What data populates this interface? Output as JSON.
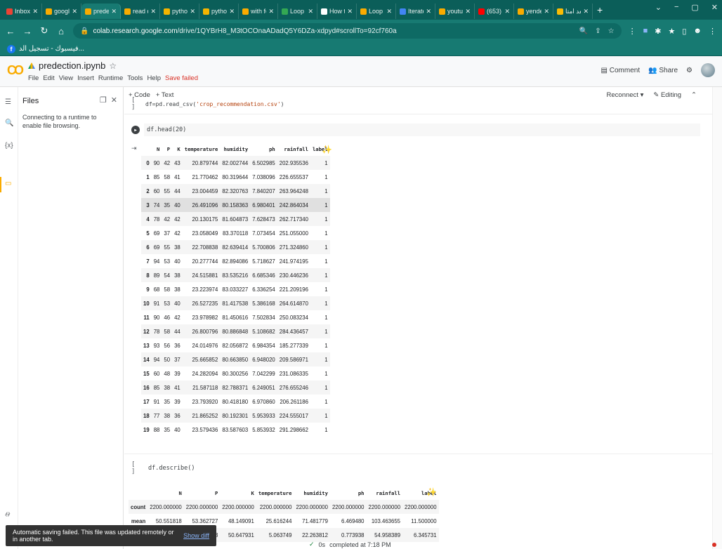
{
  "browser": {
    "tabs": [
      {
        "title": "Inbox (1",
        "color": "#ea4335",
        "active": false
      },
      {
        "title": "google ·",
        "color": "#f9ab00",
        "active": false
      },
      {
        "title": "predecti",
        "color": "#f9ab00",
        "active": true
      },
      {
        "title": "read dat",
        "color": "#f9ab00",
        "active": false
      },
      {
        "title": "python",
        "color": "#f4b400",
        "active": false
      },
      {
        "title": "python",
        "color": "#f4b400",
        "active": false
      },
      {
        "title": "with for",
        "color": "#f9ab00",
        "active": false
      },
      {
        "title": "Loop or",
        "color": "#34a853",
        "active": false
      },
      {
        "title": "How to",
        "color": "#ffffff",
        "active": false
      },
      {
        "title": "Loop or",
        "color": "#f9ab00",
        "active": false
      },
      {
        "title": "Iterate T",
        "color": "#4285f4",
        "active": false
      },
      {
        "title": "youtub",
        "color": "#f9ab00",
        "active": false
      },
      {
        "title": "(653) C",
        "color": "#ff0000",
        "active": false
      },
      {
        "title": "yendex",
        "color": "#f9ab00",
        "active": false
      },
      {
        "title": "بعد امتا",
        "color": "#fbbc04",
        "active": false
      }
    ],
    "new_tab": "+",
    "url_host": "colab.research.google.com",
    "url_path": "/drive/1QYBrH8_M3tOCOnaADadQ5Y6DZa-xdpyd#scrollTo=92cf760a",
    "bookmark": "فيسبوك - تسجيل الد..."
  },
  "colab": {
    "logo": "CO",
    "notebook_title": "predection.ipynb",
    "menu": [
      "File",
      "Edit",
      "View",
      "Insert",
      "Runtime",
      "Tools",
      "Help"
    ],
    "save_status": "Save failed",
    "comment": "Comment",
    "share": "Share"
  },
  "sidebar": {
    "title": "Files",
    "message": "Connecting to a runtime to enable file browsing."
  },
  "toolbar": {
    "add_code": "+ Code",
    "add_text": "+ Text",
    "reconnect": "Reconnect",
    "editing": "Editing"
  },
  "cells": {
    "read_csv_pre": "df=pd.read_csv(",
    "read_csv_str": "'crop_recommendation.csv'",
    "read_csv_post": ")",
    "head": "df.head(20)",
    "describe": "df.describe()",
    "bracket": "[ ]"
  },
  "head_table": {
    "columns": [
      "N",
      "P",
      "K",
      "temperature",
      "humidity",
      "ph",
      "rainfall",
      "label"
    ],
    "rows": [
      [
        "0",
        "90",
        "42",
        "43",
        "20.879744",
        "82.002744",
        "6.502985",
        "202.935536",
        "1"
      ],
      [
        "1",
        "85",
        "58",
        "41",
        "21.770462",
        "80.319644",
        "7.038096",
        "226.655537",
        "1"
      ],
      [
        "2",
        "60",
        "55",
        "44",
        "23.004459",
        "82.320763",
        "7.840207",
        "263.964248",
        "1"
      ],
      [
        "3",
        "74",
        "35",
        "40",
        "26.491096",
        "80.158363",
        "6.980401",
        "242.864034",
        "1"
      ],
      [
        "4",
        "78",
        "42",
        "42",
        "20.130175",
        "81.604873",
        "7.628473",
        "262.717340",
        "1"
      ],
      [
        "5",
        "69",
        "37",
        "42",
        "23.058049",
        "83.370118",
        "7.073454",
        "251.055000",
        "1"
      ],
      [
        "6",
        "69",
        "55",
        "38",
        "22.708838",
        "82.639414",
        "5.700806",
        "271.324860",
        "1"
      ],
      [
        "7",
        "94",
        "53",
        "40",
        "20.277744",
        "82.894086",
        "5.718627",
        "241.974195",
        "1"
      ],
      [
        "8",
        "89",
        "54",
        "38",
        "24.515881",
        "83.535216",
        "6.685346",
        "230.446236",
        "1"
      ],
      [
        "9",
        "68",
        "58",
        "38",
        "23.223974",
        "83.033227",
        "6.336254",
        "221.209196",
        "1"
      ],
      [
        "10",
        "91",
        "53",
        "40",
        "26.527235",
        "81.417538",
        "5.386168",
        "264.614870",
        "1"
      ],
      [
        "11",
        "90",
        "46",
        "42",
        "23.978982",
        "81.450616",
        "7.502834",
        "250.083234",
        "1"
      ],
      [
        "12",
        "78",
        "58",
        "44",
        "26.800796",
        "80.886848",
        "5.108682",
        "284.436457",
        "1"
      ],
      [
        "13",
        "93",
        "56",
        "36",
        "24.014976",
        "82.056872",
        "6.984354",
        "185.277339",
        "1"
      ],
      [
        "14",
        "94",
        "50",
        "37",
        "25.665852",
        "80.663850",
        "6.948020",
        "209.586971",
        "1"
      ],
      [
        "15",
        "60",
        "48",
        "39",
        "24.282094",
        "80.300256",
        "7.042299",
        "231.086335",
        "1"
      ],
      [
        "16",
        "85",
        "38",
        "41",
        "21.587118",
        "82.788371",
        "6.249051",
        "276.655246",
        "1"
      ],
      [
        "17",
        "91",
        "35",
        "39",
        "23.793920",
        "80.418180",
        "6.970860",
        "206.261186",
        "1"
      ],
      [
        "18",
        "77",
        "38",
        "36",
        "21.865252",
        "80.192301",
        "5.953933",
        "224.555017",
        "1"
      ],
      [
        "19",
        "88",
        "35",
        "40",
        "23.579436",
        "83.587603",
        "5.853932",
        "291.298662",
        "1"
      ]
    ]
  },
  "describe_table": {
    "columns": [
      "N",
      "P",
      "K",
      "temperature",
      "humidity",
      "ph",
      "rainfall",
      "label"
    ],
    "rows": [
      [
        "count",
        "2200.000000",
        "2200.000000",
        "2200.000000",
        "2200.000000",
        "2200.000000",
        "2200.000000",
        "2200.000000",
        "2200.000000"
      ],
      [
        "mean",
        "50.551818",
        "53.362727",
        "48.149091",
        "25.616244",
        "71.481779",
        "6.469480",
        "103.463655",
        "11.500000"
      ],
      [
        "std",
        "",
        "5883",
        "50.647931",
        "5.063749",
        "22.263812",
        "0.773938",
        "54.958389",
        "6.345731"
      ]
    ]
  },
  "toast": {
    "message": "Automatic saving failed. This file was updated remotely or in another tab.",
    "link": "Show diff"
  },
  "status": {
    "check": "✓",
    "duration": "0s",
    "completed": "completed at 7:18 PM"
  }
}
